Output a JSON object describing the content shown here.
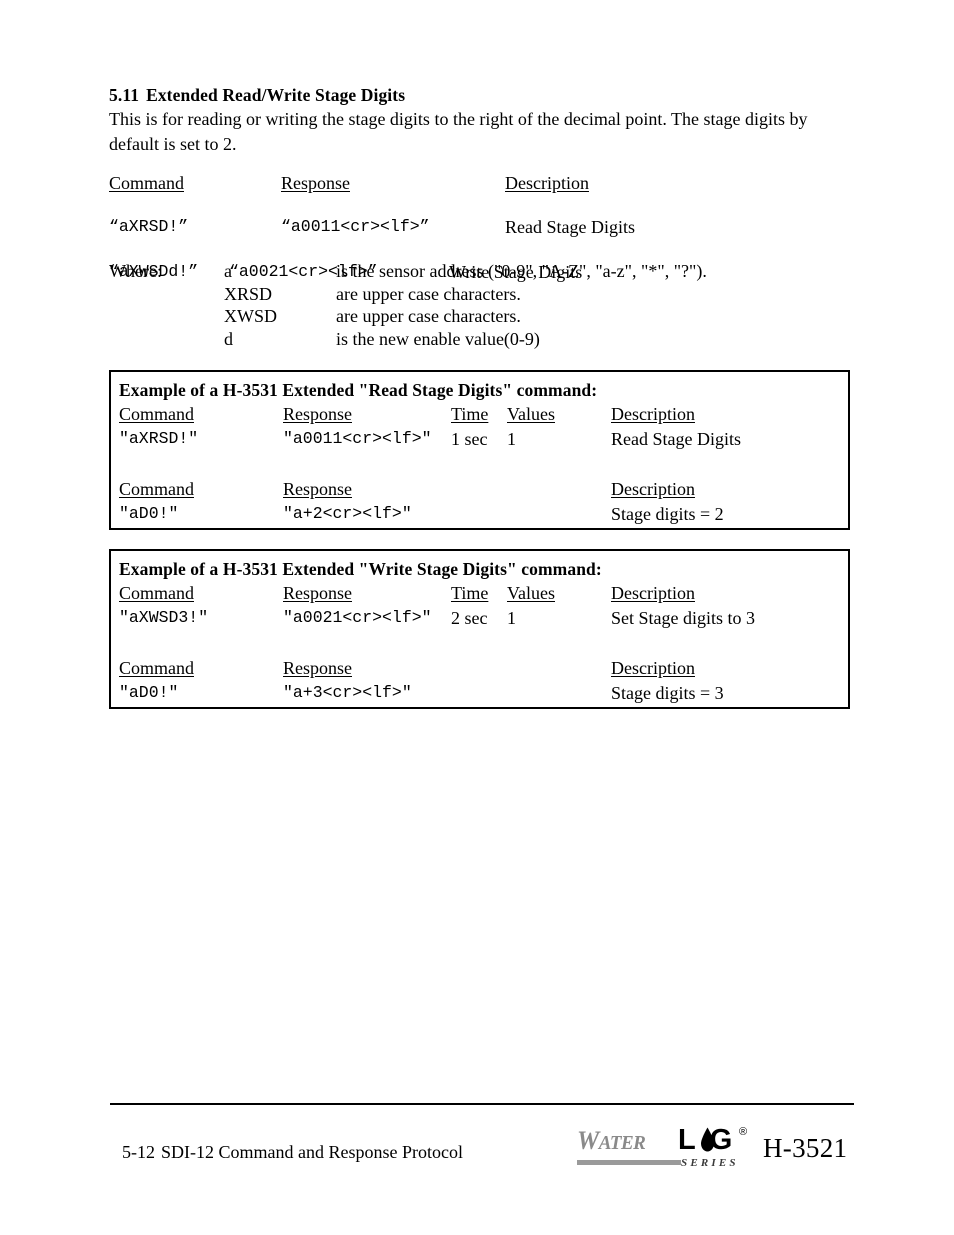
{
  "section": {
    "number": "5.11",
    "title": "Extended Read/Write Stage Digits",
    "intro": "This is for reading or writing the stage digits to the right of the decimal point. The stage digits by default is set to 2."
  },
  "top_table": {
    "headers": {
      "command": "Command",
      "response": "Response",
      "description": "Description"
    },
    "rows": [
      {
        "command": "“aXRSD!”",
        "response": "“a0011<cr><lf>”",
        "description": "Read Stage Digits"
      },
      {
        "command": "“aXWSDd!”",
        "response": "“a0021<cr><lf>”",
        "description": "Write Stage Digits"
      }
    ]
  },
  "where": {
    "label": "Where:",
    "entries": [
      {
        "term": "a",
        "desc": "is the sensor address (\"0-9\", \"A-Z\", \"a-z\", \"*\", \"?\")."
      },
      {
        "term": "XRSD",
        "desc": "are upper case characters."
      },
      {
        "term": "XWSD",
        "desc": "are upper case characters."
      },
      {
        "term": "d",
        "desc": "is the new enable value(0-9)"
      }
    ]
  },
  "example_read": {
    "title": "Example of a H-3531 Extended \"Read Stage Digits\" command:",
    "headers1": {
      "command": "Command",
      "response": "Response",
      "time": "Time",
      "values": "Values",
      "description": "Description"
    },
    "row1": {
      "command": "\"aXRSD!\"",
      "response": "\"a0011<cr><lf>\"",
      "time": "1 sec",
      "values": "1",
      "description": "Read Stage Digits"
    },
    "headers2": {
      "command": "Command",
      "response": "Response",
      "description": "Description"
    },
    "row2": {
      "command": "\"aD0!\"",
      "response": "\"a+2<cr><lf>\"",
      "description": "Stage digits = 2"
    }
  },
  "example_write": {
    "title": "Example of a H-3531 Extended \"Write Stage Digits\" command:",
    "headers1": {
      "command": "Command",
      "response": "Response",
      "time": "Time",
      "values": "Values",
      "description": "Description"
    },
    "row1": {
      "command": "\"aXWSD3!\"",
      "response": "\"a0021<cr><lf>\"",
      "time": "2 sec",
      "values": "1",
      "description": "Set Stage digits to 3"
    },
    "headers2": {
      "command": "Command",
      "response": "Response",
      "description": "Description"
    },
    "row2": {
      "command": "\"aD0!\"",
      "response": "\"a+3<cr><lf>\"",
      "description": "Stage digits = 3"
    }
  },
  "footer": {
    "page_number": "5-12",
    "chapter_title": "SDI-12 Command and Response Protocol",
    "model": "H-3521",
    "logo": {
      "water": "ATER",
      "water_initial": "W",
      "log_l": "L",
      "log_g": "G",
      "registered": "®",
      "series": "SERIES"
    }
  },
  "colors": {
    "text": "#000000",
    "logo_gray": "#8a8a8a",
    "logo_bar": "#9a9a9a",
    "page_background": "#ffffff"
  }
}
